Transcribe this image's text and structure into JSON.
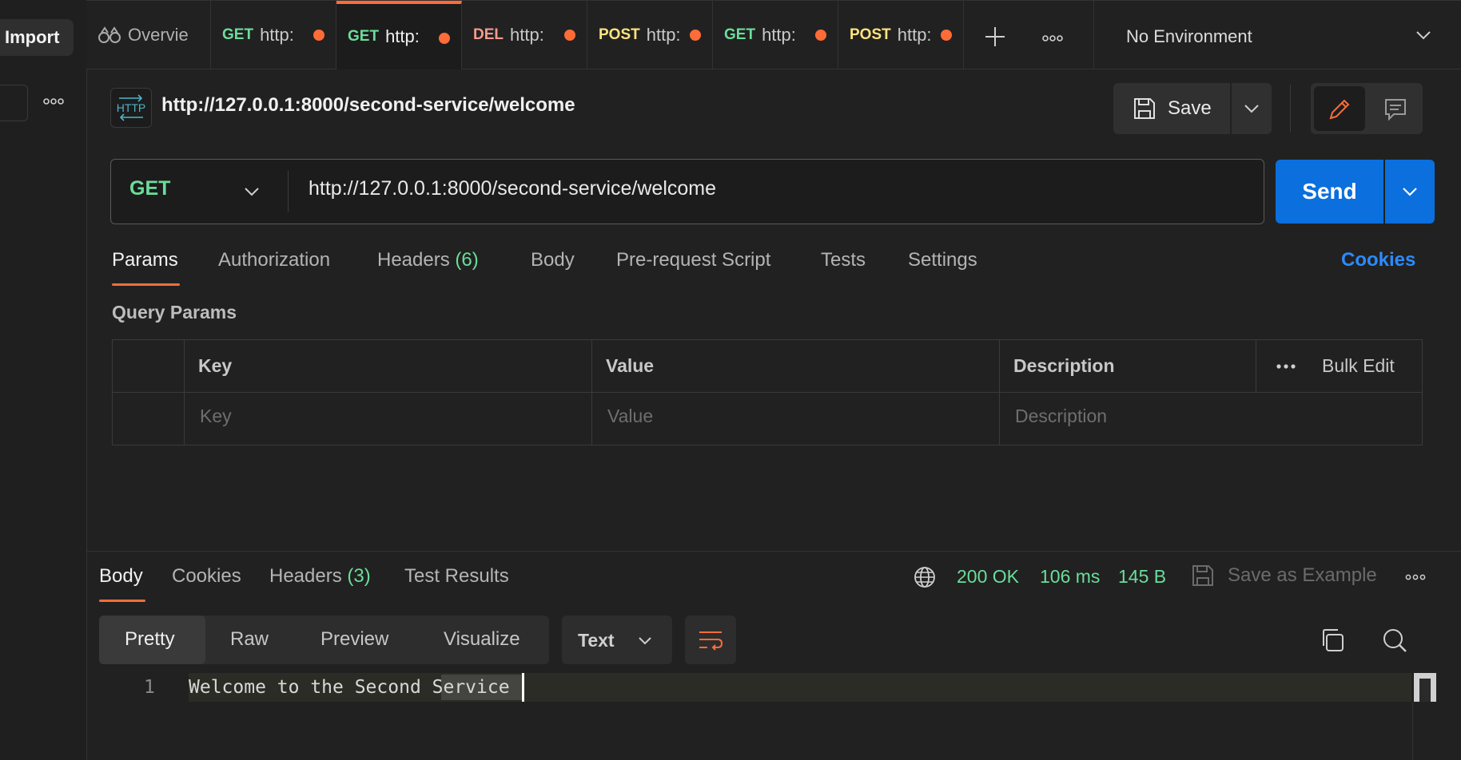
{
  "sidebar": {
    "import_label": "Import"
  },
  "tabs": [
    {
      "method": "",
      "label": "Overvie",
      "has_dot": false
    },
    {
      "method": "GET",
      "label": "http:",
      "has_dot": true
    },
    {
      "method": "GET",
      "label": "http:",
      "has_dot": true,
      "active": true
    },
    {
      "method": "DEL",
      "label": "http:",
      "has_dot": true
    },
    {
      "method": "POST",
      "label": "http:",
      "has_dot": true
    },
    {
      "method": "GET",
      "label": "http:",
      "has_dot": true
    },
    {
      "method": "POST",
      "label": "http:",
      "has_dot": true
    }
  ],
  "environment": {
    "label": "No Environment"
  },
  "request": {
    "icon_text": "HTTP",
    "title": "http://127.0.0.1:8000/second-service/welcome",
    "save_label": "Save",
    "method": "GET",
    "url": "http://127.0.0.1:8000/second-service/welcome",
    "send_label": "Send"
  },
  "request_tabs": {
    "params": "Params",
    "authorization": "Authorization",
    "headers": "Headers",
    "headers_count": "(6)",
    "body": "Body",
    "pre_request": "Pre-request Script",
    "tests": "Tests",
    "settings": "Settings",
    "cookies": "Cookies"
  },
  "query_params": {
    "title": "Query Params",
    "columns": {
      "key": "Key",
      "value": "Value",
      "description": "Description"
    },
    "placeholders": {
      "key": "Key",
      "value": "Value",
      "description": "Description"
    },
    "bulk_edit": "Bulk Edit"
  },
  "response": {
    "tabs": {
      "body": "Body",
      "cookies": "Cookies",
      "headers": "Headers",
      "headers_count": "(3)",
      "test_results": "Test Results"
    },
    "status": "200 OK",
    "time": "106 ms",
    "size": "145 B",
    "save_example": "Save as Example",
    "views": {
      "pretty": "Pretty",
      "raw": "Raw",
      "preview": "Preview",
      "visualize": "Visualize"
    },
    "format": "Text",
    "line_number": "1",
    "body_text": "Welcome to the Second Service"
  },
  "colors": {
    "accent": "#ff6c37",
    "send_blue": "#0b6fde",
    "get_green": "#6bdd9a",
    "post_yellow": "#ffe47e",
    "del_red": "#f79a8e",
    "cookies_link": "#2b8bff"
  }
}
